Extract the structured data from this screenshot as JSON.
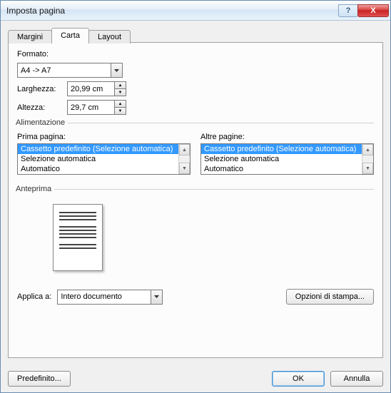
{
  "title": "Imposta pagina",
  "tabs": {
    "margini": "Margini",
    "carta": "Carta",
    "layout": "Layout",
    "active": "carta"
  },
  "formato": {
    "legend": "Formato:",
    "paper_selected": "A4 -> A7",
    "larghezza_label": "Larghezza:",
    "larghezza_value": "20,99 cm",
    "altezza_label": "Altezza:",
    "altezza_value": "29,7 cm"
  },
  "alimentazione": {
    "legend": "Alimentazione",
    "prima_label": "Prima pagina:",
    "altre_label": "Altre pagine:",
    "items": [
      "Cassetto predefinito (Selezione automatica)",
      "Selezione automatica",
      "Automatico"
    ]
  },
  "anteprima": {
    "legend": "Anteprima"
  },
  "applica": {
    "label": "Applica a:",
    "value": "Intero documento"
  },
  "buttons": {
    "opzioni": "Opzioni di stampa...",
    "predefinito": "Predefinito...",
    "ok": "OK",
    "annulla": "Annulla"
  }
}
